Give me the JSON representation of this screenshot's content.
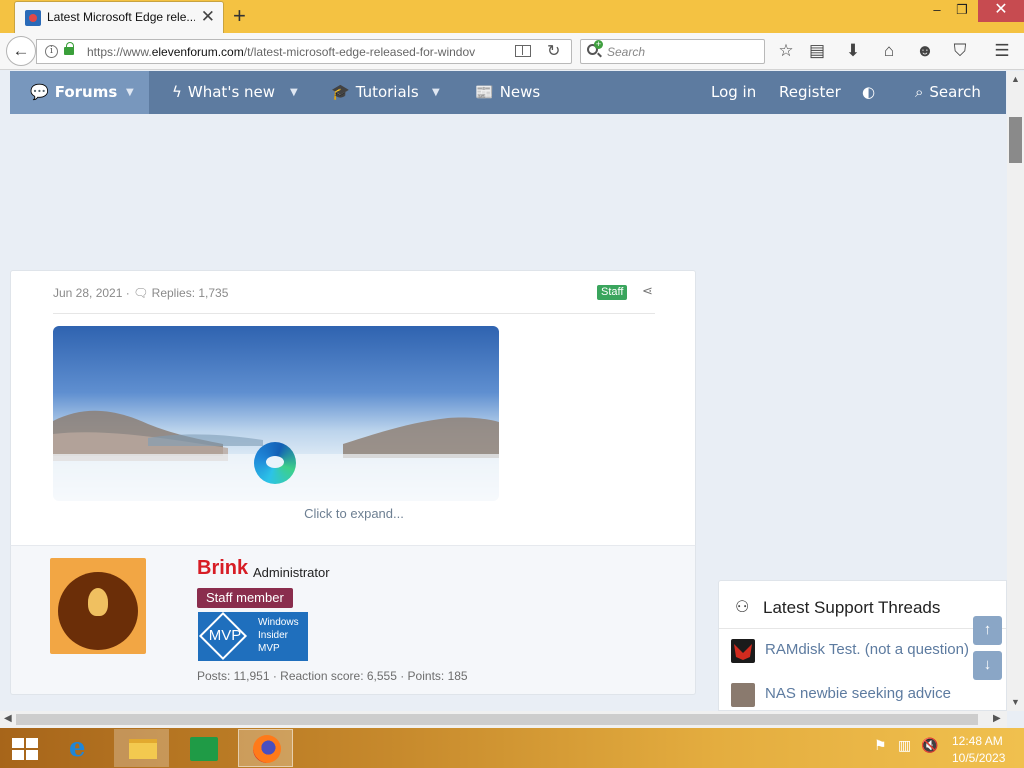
{
  "browser": {
    "tab_title": "Latest Microsoft Edge rele...",
    "tab_close": "✕",
    "new_tab": "+",
    "window_controls": {
      "minimize": "–",
      "maximize": "❐",
      "close": "✕"
    },
    "url_prefix": "https://www.",
    "url_domain": "elevenforum.com",
    "url_path": "/t/latest-microsoft-edge-released-for-windov",
    "search_placeholder": "Search",
    "toolbar_icons": [
      "star-icon",
      "reading-list-icon",
      "download-icon",
      "home-icon",
      "emoji-icon",
      "pocket-icon",
      "menu-icon"
    ]
  },
  "site_nav": {
    "forums": "Forums",
    "whats_new": "What's new",
    "tutorials": "Tutorials",
    "news": "News",
    "login": "Log in",
    "register": "Register",
    "search": "Search"
  },
  "post": {
    "date": "Jun 28, 2021",
    "replies": "Replies: 1,735",
    "staff_badge": "Staff",
    "expand_link": "Click to expand..."
  },
  "user": {
    "name": "Brink",
    "title": "Administrator",
    "banner": "Staff member",
    "mvp": "MVP",
    "mvp_line1": "Windows",
    "mvp_line2": "Insider",
    "mvp_line3": "MVP",
    "stats": "Posts: 11,951 · Reaction score: 6,555 · Points: 185"
  },
  "support": {
    "title": "Latest Support Threads",
    "threads": [
      {
        "title": "RAMdisk Test. (not a question)"
      },
      {
        "title": "NAS newbie seeking advice"
      }
    ]
  },
  "taskbar": {
    "clock_time": "12:48 AM",
    "clock_date": "10/5/2023"
  },
  "colors": {
    "nav_bg": "#5d7ba0",
    "nav_active": "#7897bd",
    "username": "#d71d25",
    "staff_member": "#8a2d4d",
    "staff_badge": "#3aa55d",
    "mvp_blue": "#1f6fbd",
    "link": "#5d7ba0"
  }
}
